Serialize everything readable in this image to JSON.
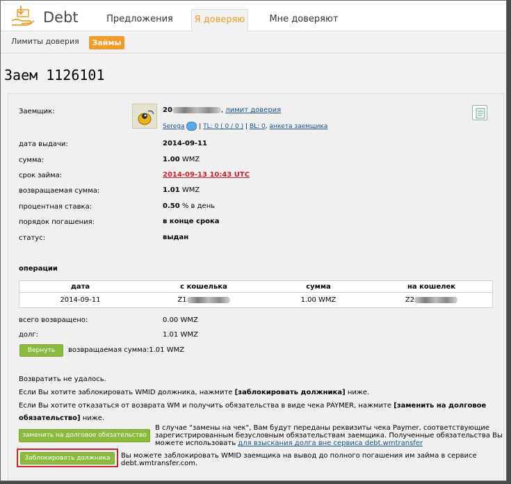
{
  "app": {
    "name": "Debt"
  },
  "tabs": [
    {
      "label": "Предложения"
    },
    {
      "label": "Я доверяю"
    },
    {
      "label": "Мне доверяют"
    }
  ],
  "subtabs": [
    {
      "label": "Лимиты доверия"
    },
    {
      "label": "Займы"
    }
  ],
  "page_title": "Заем 1126101",
  "loan": {
    "borrower_label": "Заемщик:",
    "borrower_wmid_prefix": "20",
    "borrower_wmid_suffix": ",",
    "trust_limit_link": "лимит доверия",
    "nick": "Serega",
    "tl_text": "TL: 0 ( 0 / 0 )",
    "bl_text": "BL: 0",
    "profile_link": "анкета заемщика",
    "rows": [
      {
        "label": "дата выдачи:",
        "value": "2014-09-11"
      },
      {
        "label": "сумма:",
        "value": "1.00",
        "unit": "WMZ"
      },
      {
        "label": "срок займа:",
        "value": "2014-09-13 10:43 UTC"
      },
      {
        "label": "возвращаемая сумма:",
        "value": "1.01",
        "unit": "WMZ"
      },
      {
        "label": "процентная ставка:",
        "value": "0.50",
        "unit": "% в день"
      },
      {
        "label": "порядок погашения:",
        "value": "в конце срока"
      },
      {
        "label": "статус:",
        "value": "выдан"
      }
    ]
  },
  "operations": {
    "title": "операции",
    "headers": [
      "дата",
      "с кошелька",
      "сумма",
      "на кошелек"
    ],
    "rows": [
      {
        "date": "2014-09-11",
        "from": "Z1",
        "amount": "1.00 WMZ",
        "to": "Z2"
      }
    ]
  },
  "totals": {
    "returned_label": "всего возвращено:",
    "returned_value": "0.00 WMZ",
    "debt_label": "долг:",
    "debt_value": "1.01 WMZ"
  },
  "return_button": "Вернуть",
  "return_amount_text": "возвращаемая сумма:1.01 WMZ",
  "messages": {
    "failed": "Возвратить не удалось.",
    "block_hint_a": "Если Вы хотите заблокировать WMID должника, нажмите ",
    "block_hint_b": "[заблокировать должника]",
    "block_hint_c": " ниже.",
    "exchange_hint_a": "Если Вы хотите отказаться от возврата WM и получить обязательства в виде чека PAYMER, нажмите ",
    "exchange_hint_b": "[заменить на долговое",
    "exchange_hint_c": "обязательство]",
    "exchange_hint_d": " ниже."
  },
  "exchange_button": "заменить на долговое обязательство",
  "exchange_note": {
    "l1": "В случае \"замены на чек\", Вам будут переданы реквизиты чека Paymer, соответствующие",
    "l2": "зарегистрированным безусловным обязательствам заемщика. Полученные обязательства Вы",
    "l3": "можете использовать ",
    "l3_link": "для взыскания долга вне сервиса debt.wmtransfer"
  },
  "block_button": "Заблокировать должника",
  "block_note": {
    "l1": "Вы можете заблокировать WMID заемщика на вывод до полного погашения им займа в сервисе",
    "l2": "debt.wmtransfer.com."
  },
  "colors": {
    "accent": "#f39a27",
    "button": "#8bba3e",
    "highlight": "#d21f2b",
    "deadline": "#d21f2b"
  }
}
